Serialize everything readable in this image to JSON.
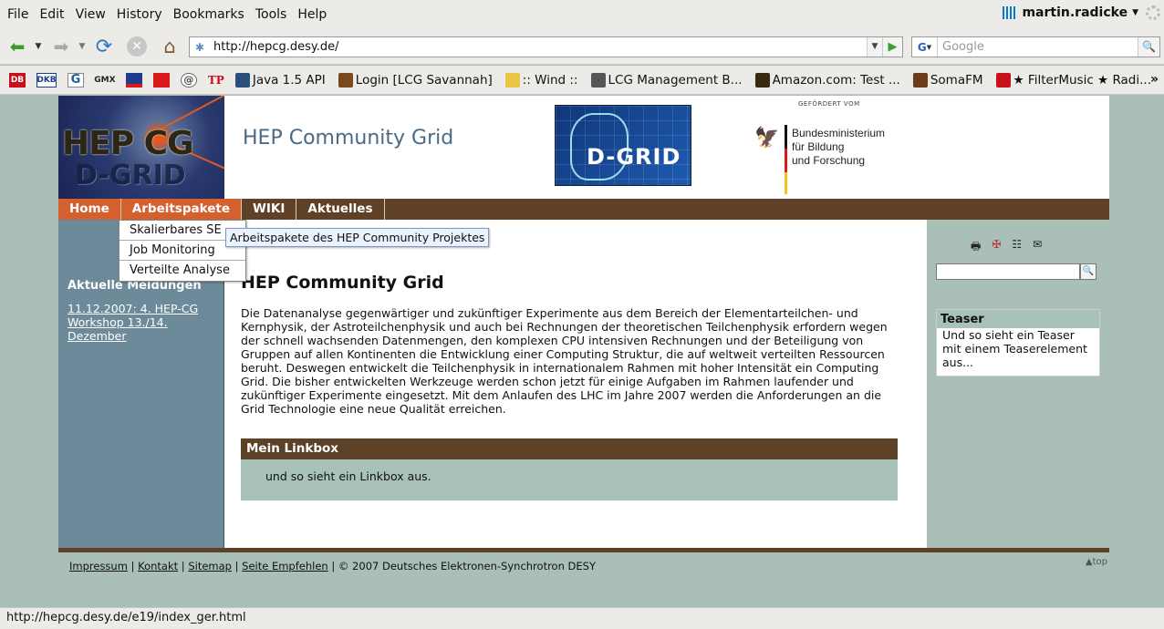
{
  "browser": {
    "menu": [
      {
        "label": "File"
      },
      {
        "label": "Edit"
      },
      {
        "label": "View"
      },
      {
        "label": "History"
      },
      {
        "label": "Bookmarks"
      },
      {
        "label": "Tools"
      },
      {
        "label": "Help"
      }
    ],
    "user": "martin.radicke",
    "url": "http://hepcg.desy.de/",
    "search_placeholder": "Google",
    "bookmarks": [
      {
        "label": "Java 1.5 API",
        "icon": "sun-icon",
        "color": "#2a4f7a"
      },
      {
        "label": "Login [LCG Savannah]",
        "icon": "gnu-icon",
        "color": "#7a4a1e"
      },
      {
        "label": ":: Wind ::",
        "icon": "folder-icon",
        "color": "#e8c545"
      },
      {
        "label": "LCG Management B...",
        "icon": "lcg-icon",
        "color": "#555555"
      },
      {
        "label": "Amazon.com: Test ...",
        "icon": "amazon-icon",
        "color": "#3b2a12"
      },
      {
        "label": "SomaFM",
        "icon": "somafm-icon",
        "color": "#6a3c1a"
      },
      {
        "label": "★ FilterMusic ★ Radi...",
        "icon": "filtermusic-icon",
        "color": "#c8101a"
      }
    ],
    "bookmark_icons": [
      "DB",
      "DKB",
      "G",
      "GMX",
      "",
      "",
      "@",
      "TP"
    ],
    "status": "http://hepcg.desy.de/e19/index_ger.html"
  },
  "header": {
    "logo_line1": "HEP CG",
    "logo_line2": "D-GRID",
    "title": "HEP Community Grid",
    "dgrid_text": "D-GRID",
    "bmbf_small": "GEFÖRDERT VOM",
    "bmbf_line1": "Bundesministerium",
    "bmbf_line2": "für Bildung",
    "bmbf_line3": "und Forschung"
  },
  "nav": {
    "tabs": [
      {
        "label": "Home"
      },
      {
        "label": "Arbeitspakete"
      },
      {
        "label": "WIKI"
      },
      {
        "label": "Aktuelles"
      }
    ],
    "dropdown": [
      {
        "label": "Skalierbares SE"
      },
      {
        "label": "Job Monitoring"
      },
      {
        "label": "Verteilte Analyse"
      }
    ],
    "tooltip": "Arbeitspakete des HEP Community Projektes"
  },
  "left": {
    "heading": "Aktuelle Meldungen",
    "news_link": "11.12.2007: 4. HEP-CG Workshop 13./14. Dezember"
  },
  "main": {
    "title": "HEP Community Grid",
    "text": "Die Datenanalyse gegenwärtiger und zukünftiger Experimente aus dem Bereich der Elementarteilchen- und Kernphysik, der Astroteilchenphysik und auch bei Rechnungen der theoretischen Teilchenphysik erfordern wegen der schnell wachsenden Datenmengen, den komplexen CPU intensiven Rechnungen und der Beteiligung von Gruppen auf allen Kontinenten die Entwicklung einer Computing Struktur, die auf weltweit verteilten Ressourcen beruht. Deswegen entwickelt die Teilchenphysik in internationalem Rahmen mit hoher Intensität ein Computing Grid. Die bisher entwickelten Werkzeuge werden schon jetzt für einige Aufgaben im Rahmen laufender und zukünftiger Experimente eingesetzt. Mit dem Anlaufen des LHC im Jahre 2007 werden die Anforderungen an die Grid Technologie eine neue Qualität erreichen.",
    "linkbox_title": "Mein Linkbox",
    "linkbox_text": "und so sieht ein Linkbox aus."
  },
  "right": {
    "teaser_title": "Teaser",
    "teaser_text": "Und so sieht ein Teaser mit einem Teaserelement aus..."
  },
  "footer": {
    "links": [
      {
        "label": "Impressum"
      },
      {
        "label": "Kontakt"
      },
      {
        "label": "Sitemap"
      },
      {
        "label": "Seite Empfehlen"
      }
    ],
    "copyright": "© 2007 Deutsches Elektronen-Synchrotron DESY",
    "top": "top"
  }
}
